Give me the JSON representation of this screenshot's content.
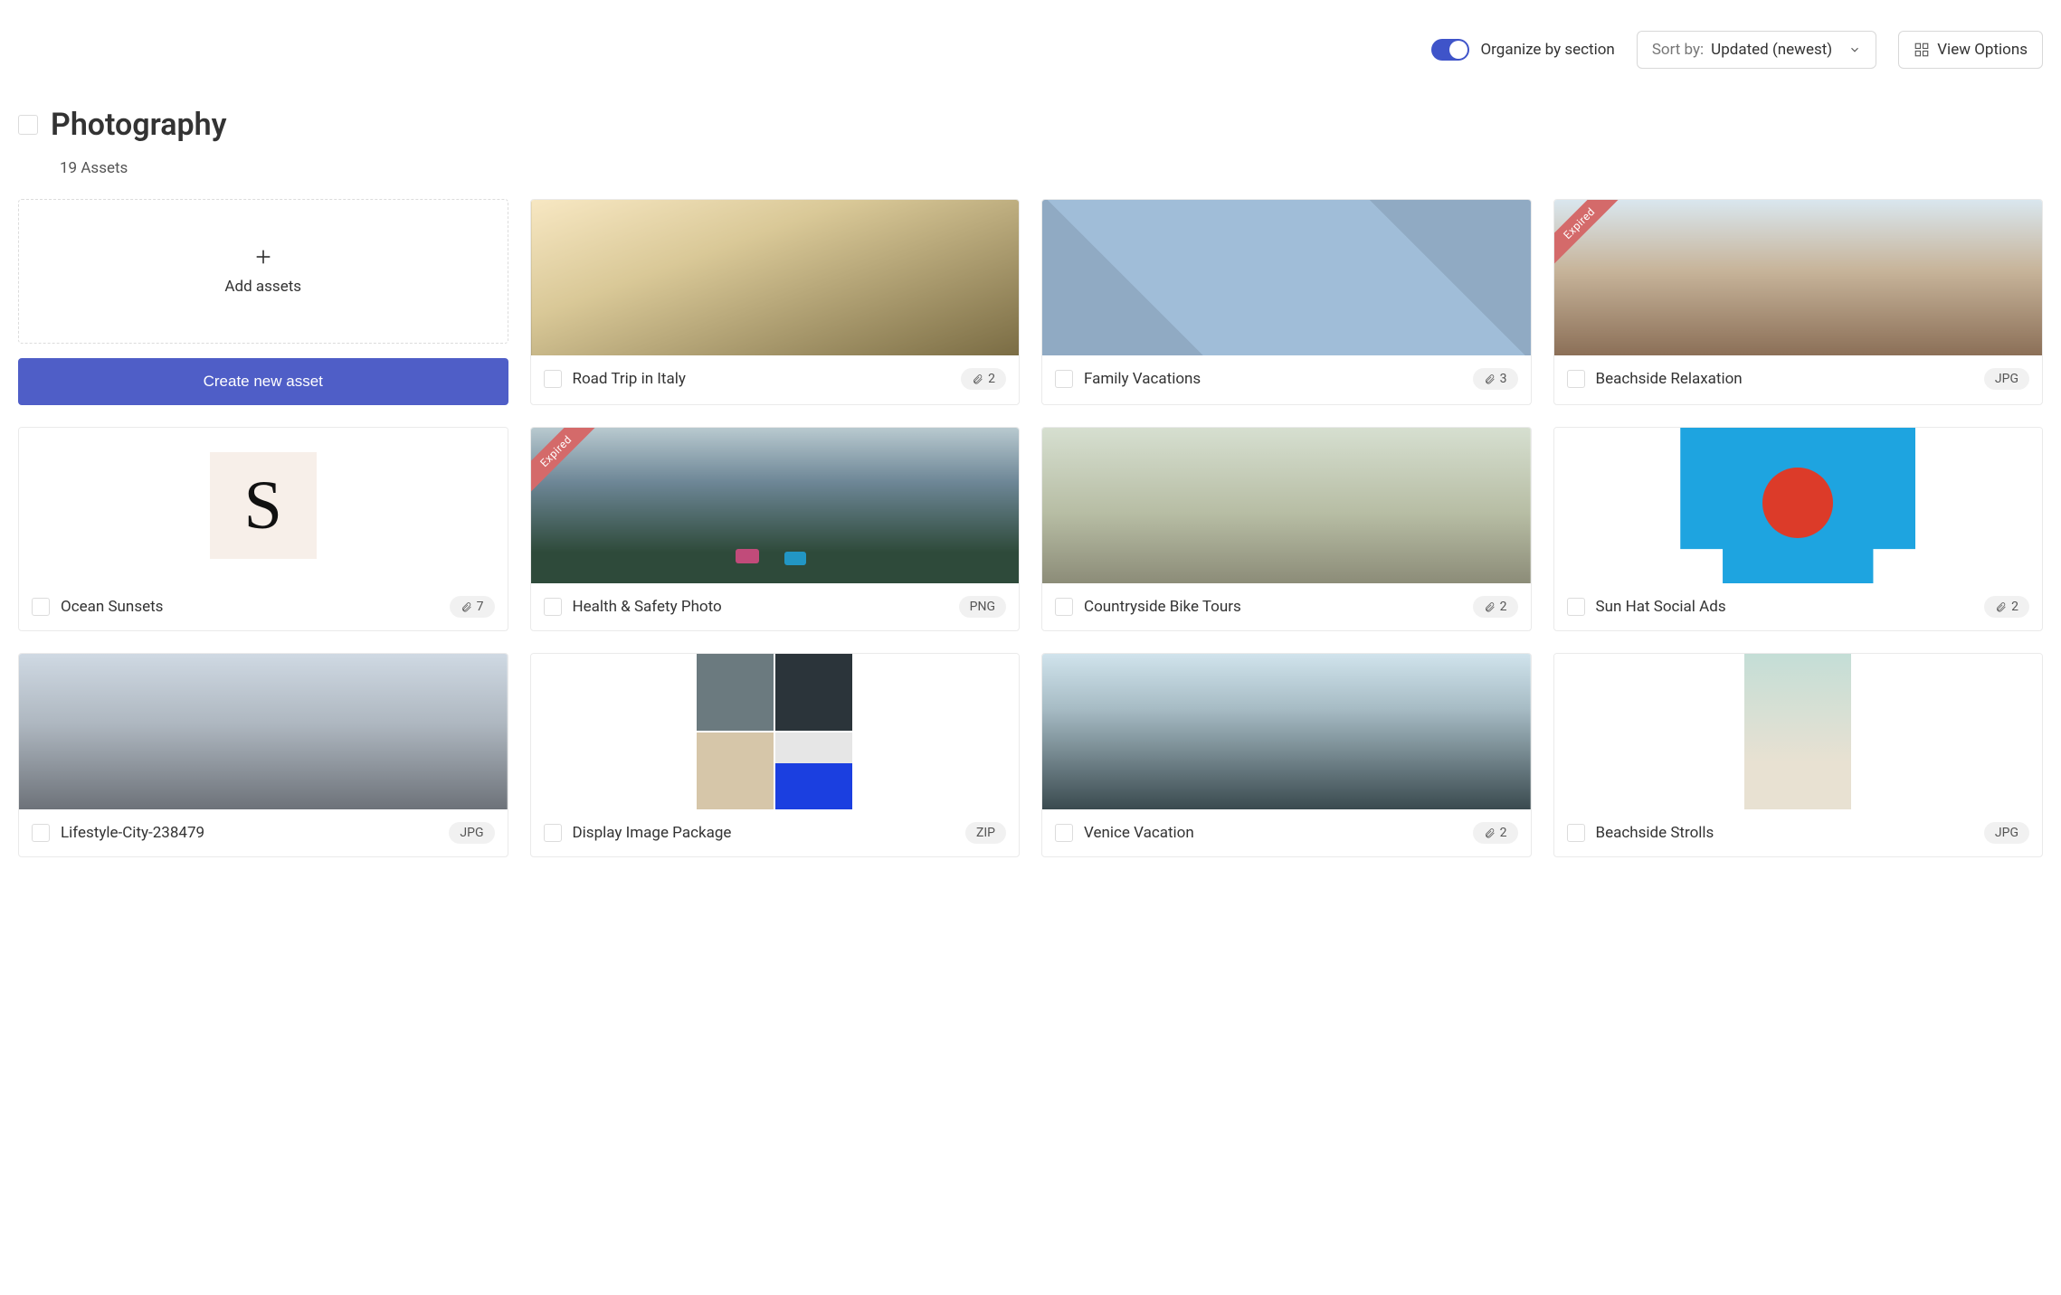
{
  "toolbar": {
    "organize_label": "Organize by section",
    "sort_label": "Sort by:",
    "sort_value": "Updated (newest)",
    "view_options_label": "View Options"
  },
  "section": {
    "title": "Photography",
    "count_label": "19 Assets"
  },
  "actions": {
    "add_assets_label": "Add assets",
    "create_asset_label": "Create new asset"
  },
  "badges": {
    "expired": "Expired"
  },
  "assets": [
    {
      "title": "Road Trip in Italy",
      "badge_type": "attach",
      "badge_value": "2",
      "thumb": "t-roadtrip",
      "expired": false
    },
    {
      "title": "Family Vacations",
      "badge_type": "attach",
      "badge_value": "3",
      "thumb": "t-family",
      "expired": false
    },
    {
      "title": "Beachside Relaxation",
      "badge_type": "format",
      "badge_value": "JPG",
      "thumb": "t-beachrelax",
      "expired": true
    },
    {
      "title": "Ocean Sunsets",
      "badge_type": "attach",
      "badge_value": "7",
      "thumb": "t-sonata",
      "expired": false
    },
    {
      "title": "Health & Safety Photo",
      "badge_type": "format",
      "badge_value": "PNG",
      "thumb": "t-health",
      "expired": true
    },
    {
      "title": "Countryside Bike Tours",
      "badge_type": "attach",
      "badge_value": "2",
      "thumb": "t-bike",
      "expired": false
    },
    {
      "title": "Sun Hat Social Ads",
      "badge_type": "attach",
      "badge_value": "2",
      "thumb": "t-sunhat",
      "expired": false
    },
    {
      "title": "Lifestyle-City-238479",
      "badge_type": "format",
      "badge_value": "JPG",
      "thumb": "t-lifecity",
      "expired": false
    },
    {
      "title": "Display Image Package",
      "badge_type": "format",
      "badge_value": "ZIP",
      "thumb": "t-display",
      "expired": false
    },
    {
      "title": "Venice Vacation",
      "badge_type": "attach",
      "badge_value": "2",
      "thumb": "t-venice",
      "expired": false
    },
    {
      "title": "Beachside Strolls",
      "badge_type": "format",
      "badge_value": "JPG",
      "thumb": "t-strolls",
      "expired": false
    }
  ]
}
